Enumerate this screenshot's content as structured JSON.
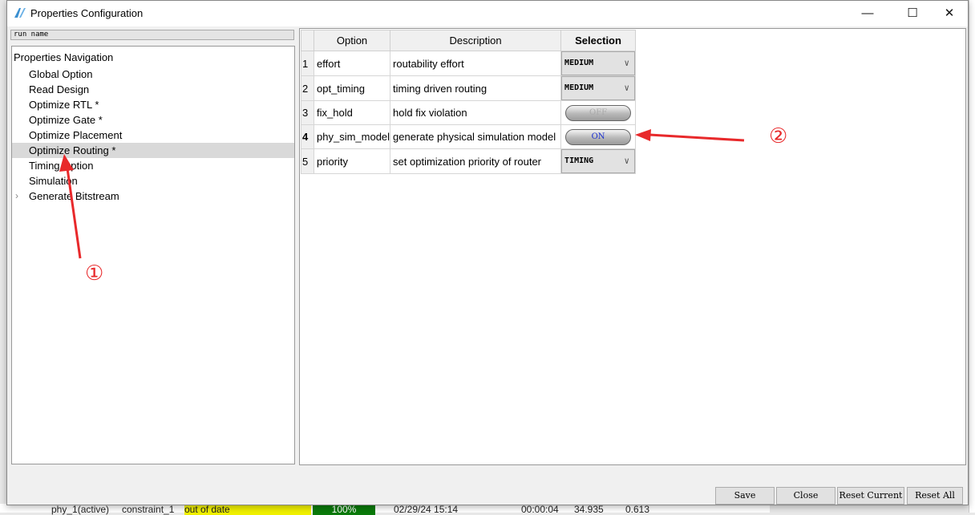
{
  "window": {
    "title": "Properties Configuration",
    "minimize": "—",
    "maximize": "☐",
    "close": "✕"
  },
  "run_name": "run name",
  "nav": {
    "title": "Properties Navigation",
    "items": [
      {
        "label": "Global Option"
      },
      {
        "label": "Read Design"
      },
      {
        "label": "Optimize RTL *"
      },
      {
        "label": "Optimize Gate *"
      },
      {
        "label": "Optimize Placement"
      },
      {
        "label": "Optimize Routing *",
        "selected": true
      },
      {
        "label": "Timing Option"
      },
      {
        "label": "Simulation"
      },
      {
        "label": "Generate Bitstream",
        "expandable": true
      }
    ]
  },
  "table": {
    "headers": [
      "Option",
      "Description",
      "Selection"
    ],
    "rows": [
      {
        "num": "1",
        "option": "effort",
        "description": "routability effort",
        "selection": "MEDIUM",
        "type": "combo"
      },
      {
        "num": "2",
        "option": "opt_timing",
        "description": "timing driven routing",
        "selection": "MEDIUM",
        "type": "combo"
      },
      {
        "num": "3",
        "option": "fix_hold",
        "description": "hold fix violation",
        "selection": "OFF",
        "type": "toggle"
      },
      {
        "num": "4",
        "option": "phy_sim_model",
        "description": "generate physical simulation model",
        "selection": "ON",
        "type": "toggle"
      },
      {
        "num": "5",
        "option": "priority",
        "description": "set optimization priority of router",
        "selection": "TIMING",
        "type": "combo"
      }
    ]
  },
  "buttons": {
    "save": "Save",
    "close": "Close",
    "reset_current": "Reset Current",
    "reset_all": "Reset All"
  },
  "annotations": {
    "one": "①",
    "two": "②",
    "color": "#e8292b"
  },
  "background_row": {
    "run": "phy_1(active)",
    "constraint": "constraint_1",
    "status": "out of date",
    "progress": "100%",
    "date": "02/29/24 15:14",
    "elapsed": "00:00:04",
    "v1": "34.935",
    "v2": "0.613"
  }
}
